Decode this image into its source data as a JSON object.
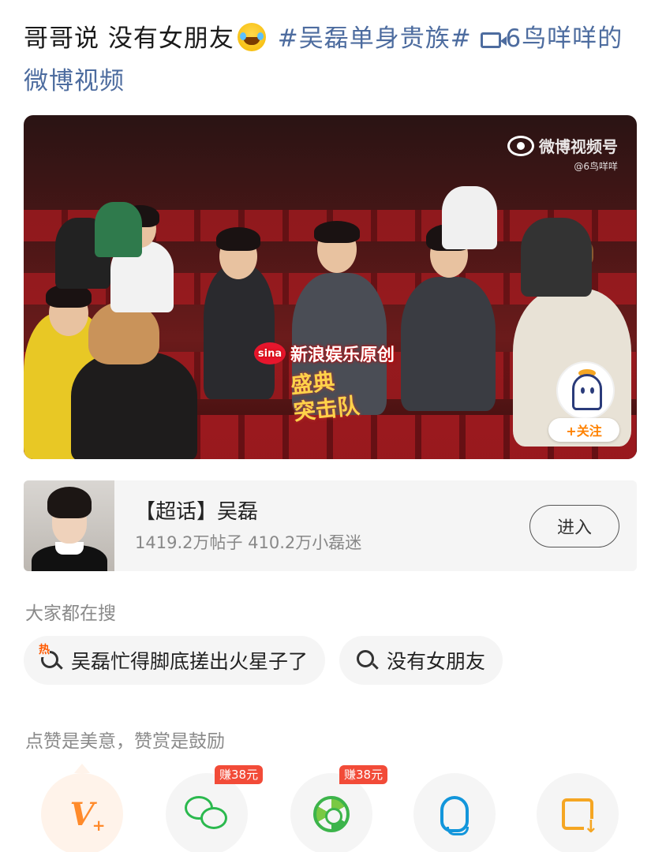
{
  "post": {
    "text_before": "哥哥说 没有女朋友",
    "emoji": "laugh-cry-emoji",
    "topic": "#吴磊单身贵族#",
    "video_link": "6鸟咩咩的微博视频"
  },
  "video": {
    "watermark_brand": "微博视频号",
    "watermark_user": "@6鸟咩咩",
    "sina_logo": "sina",
    "sina_banner": "新浪娱乐原创",
    "gala_logo_line1": "盛典",
    "gala_logo_line2": "突击队",
    "follow_label": "+关注"
  },
  "super_topic": {
    "title": "【超话】吴磊",
    "stats": "1419.2万帖子 410.2万小磊迷",
    "enter_label": "进入"
  },
  "search": {
    "label": "大家都在搜",
    "hot_char": "热",
    "items": [
      "吴磊忙得脚底搓出火星子了",
      "没有女朋友"
    ]
  },
  "reward": {
    "label": "点赞是美意，赞赏是鼓励"
  },
  "share": {
    "badges": [
      "赚38元",
      "赚38元"
    ],
    "icons": [
      "reward-v-icon",
      "wechat-icon",
      "moments-icon",
      "qq-icon",
      "save-image-icon"
    ]
  },
  "colors": {
    "link": "#4d6c9f",
    "follow_orange": "#ff8200",
    "badge_red": "#f24b38"
  }
}
